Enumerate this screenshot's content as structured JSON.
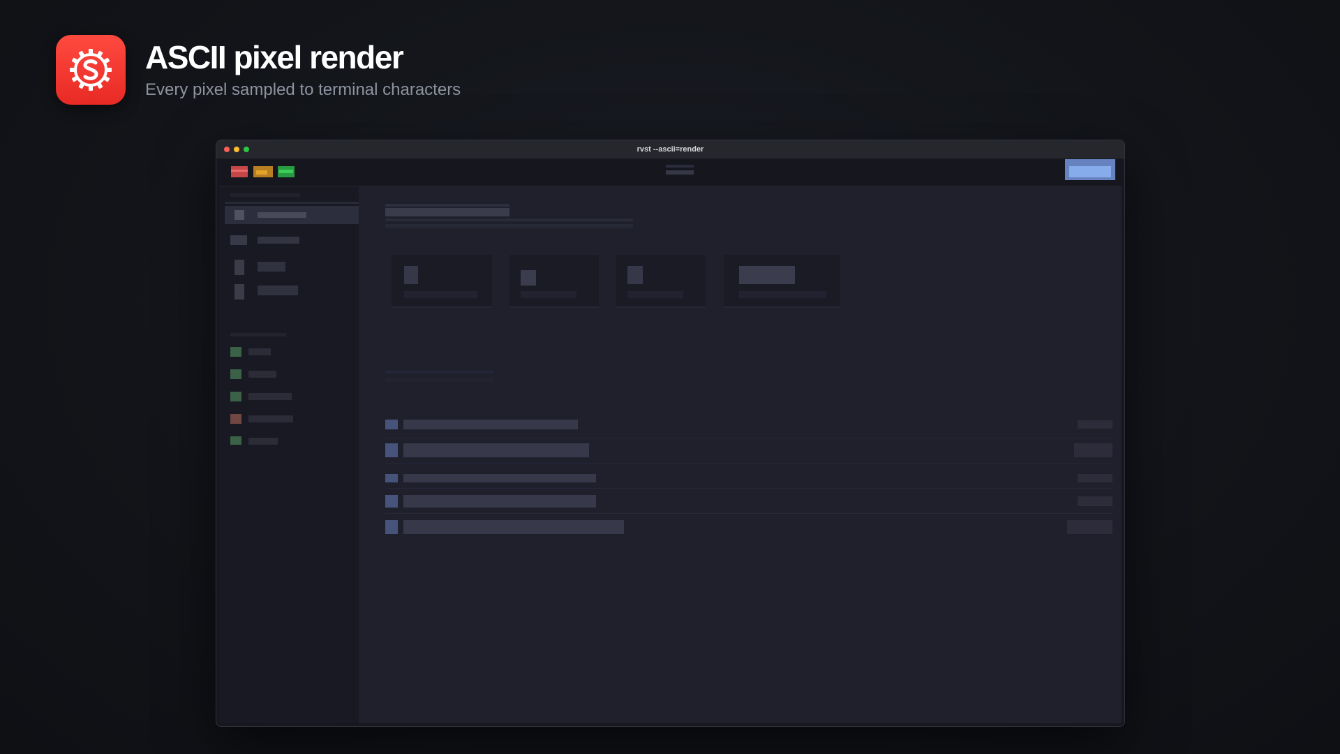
{
  "header": {
    "title": "ASCII pixel render",
    "subtitle": "Every pixel sampled to terminal characters"
  },
  "app_icon": {
    "name": "svelte-gear-icon",
    "color": "#ff3e36"
  },
  "window": {
    "title": "rvst --ascii=render",
    "traffic_lights": [
      "close",
      "minimize",
      "zoom"
    ]
  },
  "colors": {
    "accent_blue": "#8ab4f8",
    "red": "#e05555",
    "amber": "#e0a030",
    "green": "#33c24d"
  }
}
